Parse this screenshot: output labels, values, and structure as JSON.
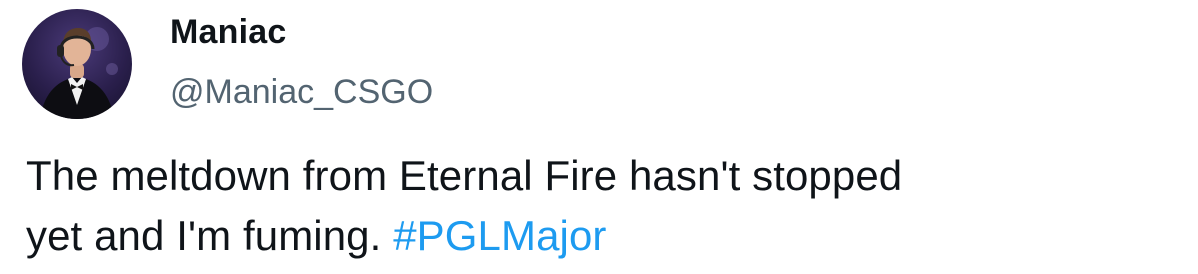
{
  "tweet": {
    "author": {
      "display_name": "Maniac",
      "handle": "@Maniac_CSGO",
      "avatar_icon": "profile-photo-icon"
    },
    "text": {
      "line1": "The meltdown from Eternal Fire hasn't stopped",
      "line2": "yet and I'm fuming. ",
      "hashtag": "#PGLMajor"
    }
  },
  "colors": {
    "text": "#0f1419",
    "secondary": "#536471",
    "link": "#1d9bf0",
    "background": "#ffffff"
  }
}
